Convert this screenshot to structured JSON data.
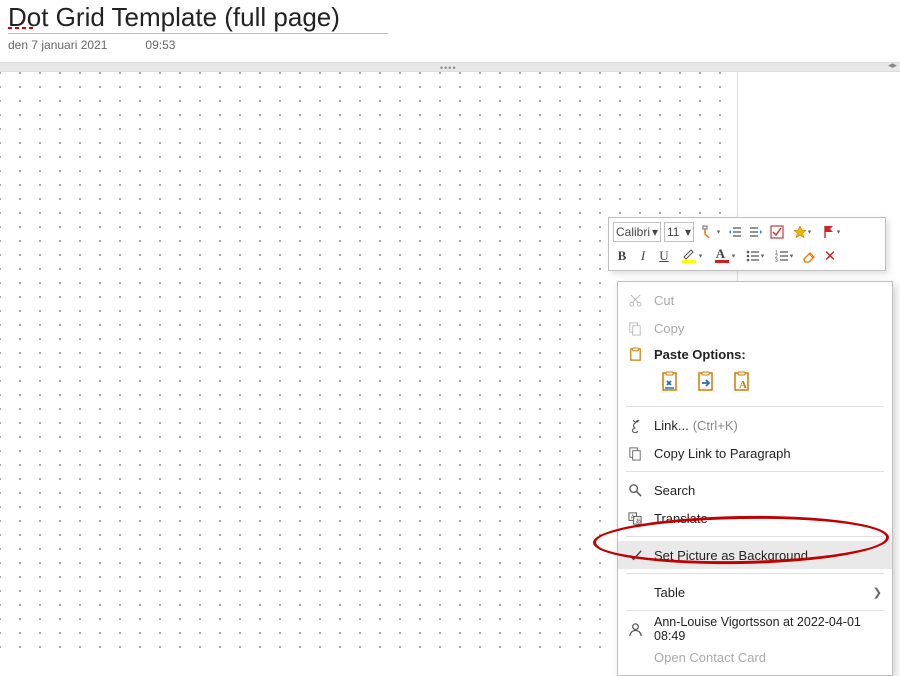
{
  "page": {
    "title": "Dot Grid Template (full page)",
    "date": "den 7 januari 2021",
    "time": "09:53"
  },
  "toolbar": {
    "font_name": "Calibri",
    "font_size": "11",
    "bold": "B",
    "italic": "I",
    "underline": "U"
  },
  "ctx": {
    "cut": "Cut",
    "copy": "Copy",
    "paste_options": "Paste Options:",
    "link": "Link...",
    "link_hint": "(Ctrl+K)",
    "copy_link_para": "Copy Link to Paragraph",
    "search": "Search",
    "translate": "Translate",
    "set_bg": "Set Picture as Background",
    "table": "Table",
    "author": "Ann-Louise Vigortsson at 2022-04-01 08:49",
    "open_contact": "Open Contact Card"
  }
}
